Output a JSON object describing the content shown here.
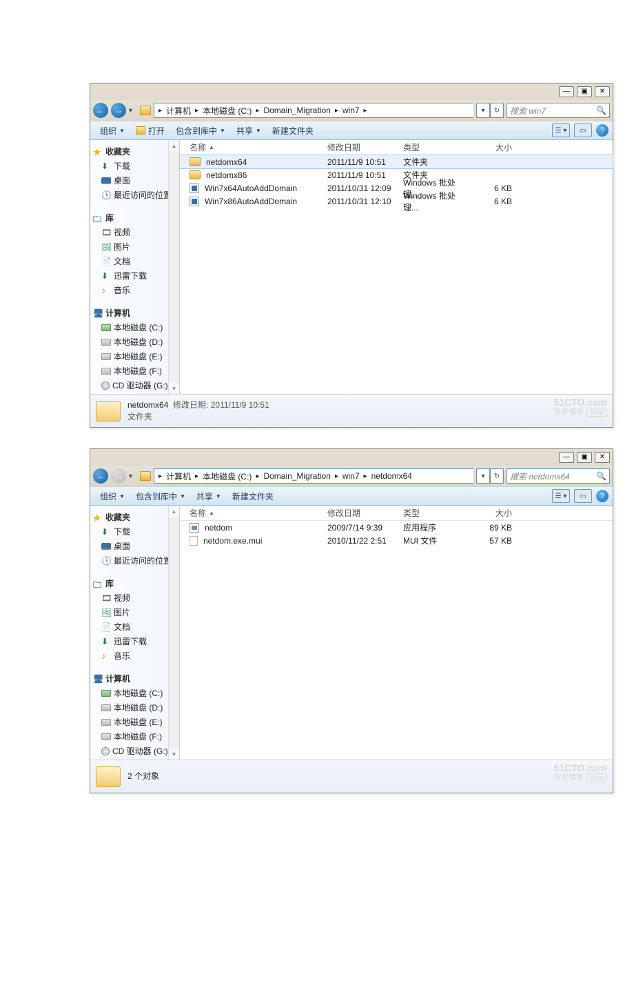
{
  "window1": {
    "title_controls": {
      "min": "—",
      "max": "▣",
      "close": "✕"
    },
    "nav": {
      "back_icon": "←",
      "fwd_icon": "→",
      "drop": "▾",
      "crumbs": [
        "计算机",
        "本地磁盘 (C:)",
        "Domain_Migration",
        "win7"
      ],
      "crumb_sep": "▸",
      "tail_sep": "▸",
      "addr_drop": "▾",
      "refresh": "↻",
      "search_placeholder": "搜索 win7",
      "search_icon": "🔍"
    },
    "toolbar": {
      "organize": "组织",
      "open": "打开",
      "include": "包含到库中",
      "share": "共享",
      "newfolder": "新建文件夹",
      "view_icon": "☰",
      "pane_icon": "▭",
      "help": "?"
    },
    "tree": {
      "favorites": {
        "label": "收藏夹",
        "items": [
          {
            "icon": "down",
            "label": "下载"
          },
          {
            "icon": "desk",
            "label": "桌面"
          },
          {
            "icon": "recent",
            "label": "最近访问的位置"
          }
        ]
      },
      "library": {
        "label": "库",
        "items": [
          {
            "icon": "vid",
            "label": "视频"
          },
          {
            "icon": "pic",
            "label": "图片"
          },
          {
            "icon": "doc",
            "label": "文档"
          },
          {
            "icon": "dl",
            "label": "迅雷下载"
          },
          {
            "icon": "music",
            "label": "音乐"
          }
        ]
      },
      "computer": {
        "label": "计算机",
        "items": [
          {
            "icon": "drvc",
            "label": "本地磁盘 (C:)"
          },
          {
            "icon": "drv",
            "label": "本地磁盘 (D:)"
          },
          {
            "icon": "drv",
            "label": "本地磁盘 (E:)"
          },
          {
            "icon": "drv",
            "label": "本地磁盘 (F:)"
          },
          {
            "icon": "cd",
            "label": "CD 驱动器 (G:)"
          }
        ]
      }
    },
    "columns": {
      "name": "名称",
      "date": "修改日期",
      "type": "类型",
      "size": "大小"
    },
    "rows": [
      {
        "sel": true,
        "ico": "folder",
        "name": "netdomx64",
        "date": "2011/11/9 10:51",
        "type": "文件夹",
        "size": ""
      },
      {
        "ico": "folder",
        "name": "netdomx86",
        "date": "2011/11/9 10:51",
        "type": "文件夹",
        "size": ""
      },
      {
        "ico": "bat",
        "name": "Win7x64AutoAddDomain",
        "date": "2011/10/31 12:09",
        "type": "Windows 批处理...",
        "size": "6 KB"
      },
      {
        "ico": "bat",
        "name": "Win7x86AutoAddDomain",
        "date": "2011/10/31 12:10",
        "type": "Windows 批处理...",
        "size": "6 KB"
      }
    ],
    "details": {
      "title": "netdomx64",
      "date_label": "修改日期:",
      "date": "2011/11/9 10:51",
      "type": "文件夹"
    }
  },
  "window2": {
    "nav": {
      "crumbs": [
        "计算机",
        "本地磁盘 (C:)",
        "Domain_Migration",
        "win7",
        "netdomx64"
      ],
      "search_placeholder": "搜索 netdomx64"
    },
    "toolbar": {
      "organize": "组织",
      "include": "包含到库中",
      "share": "共享",
      "newfolder": "新建文件夹"
    },
    "rows": [
      {
        "ico": "exe",
        "name": "netdom",
        "date": "2009/7/14 9:39",
        "type": "应用程序",
        "size": "89 KB"
      },
      {
        "ico": "file",
        "name": "netdom.exe.mui",
        "date": "2010/11/22 2:51",
        "type": "MUI 文件",
        "size": "57 KB"
      }
    ],
    "details": {
      "count": "2 个对象"
    }
  },
  "watermark": {
    "line1": "51CTO.com",
    "line2": "技术博客",
    "badge": "Blog"
  }
}
